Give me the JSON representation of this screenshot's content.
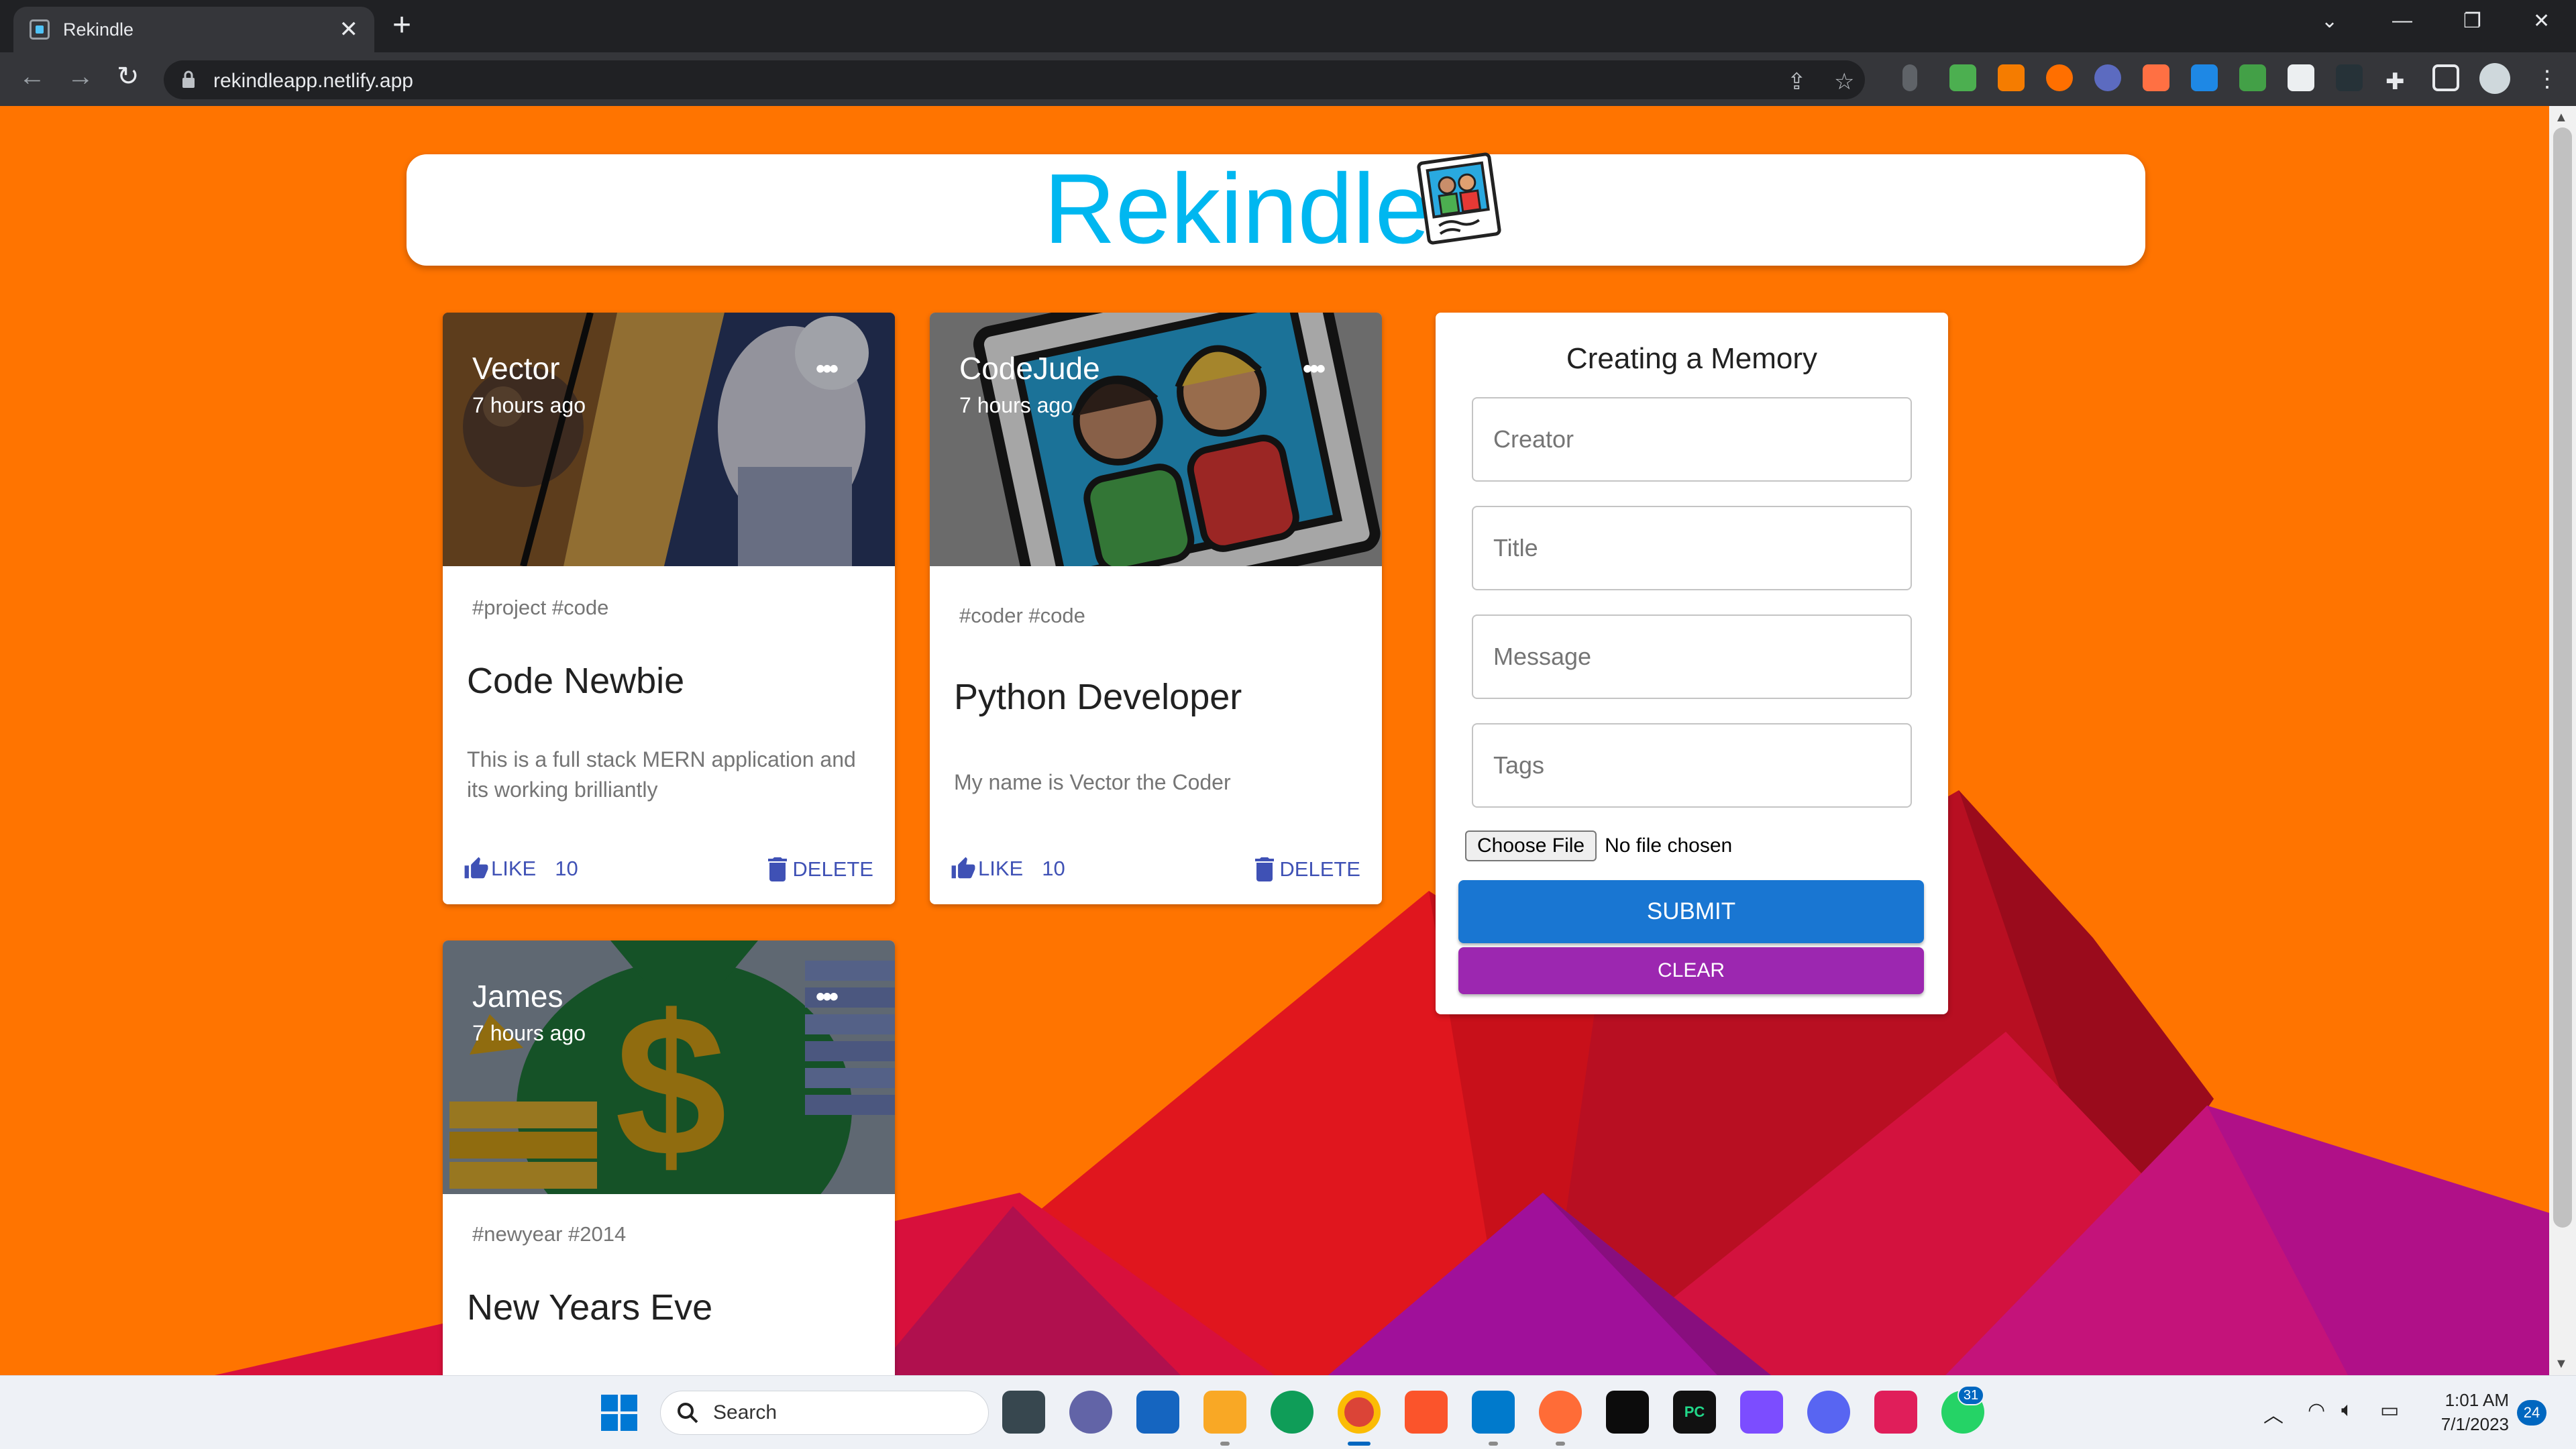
{
  "browser": {
    "tab_title": "Rekindle",
    "tab_close": "✕",
    "new_tab": "+",
    "url": "rekindleapp.netlify.app",
    "window_controls": [
      "⌄",
      "—",
      "❐",
      "✕"
    ]
  },
  "app": {
    "brand": "Rekindle",
    "colors": {
      "page_bg": "#ff7400",
      "brand": "#00b7f0",
      "action": "#3f51b5",
      "submit": "#1976d2",
      "clear": "#9c27b0"
    }
  },
  "posts": [
    {
      "creator": "Vector",
      "time": "7 hours ago",
      "more": "•••",
      "tags": "#project #code",
      "title": "Code Newbie",
      "message": "This is a full stack MERN application and its working brilliantly",
      "like_label": "LIKE",
      "like_count": "10",
      "delete_label": "DELETE"
    },
    {
      "creator": "CodeJude",
      "time": "7 hours ago",
      "more": "•••",
      "tags": "#coder #code",
      "title": "Python Developer",
      "message": "My name is Vector the Coder",
      "like_label": "LIKE",
      "like_count": "10",
      "delete_label": "DELETE"
    },
    {
      "creator": "James",
      "time": "7 hours ago",
      "more": "•••",
      "tags": "#newyear #2014",
      "title": "New Years Eve"
    }
  ],
  "form": {
    "title": "Creating a Memory",
    "creator_placeholder": "Creator",
    "title_placeholder": "Title",
    "message_placeholder": "Message",
    "tags_placeholder": "Tags",
    "file_button": "Choose File",
    "file_status": "No file chosen",
    "submit_label": "SUBMIT",
    "clear_label": "CLEAR"
  },
  "taskbar": {
    "search_label": "Search",
    "teams_badge": "31",
    "time": "1:01 AM",
    "date": "7/1/2023",
    "notification_count": "24"
  }
}
